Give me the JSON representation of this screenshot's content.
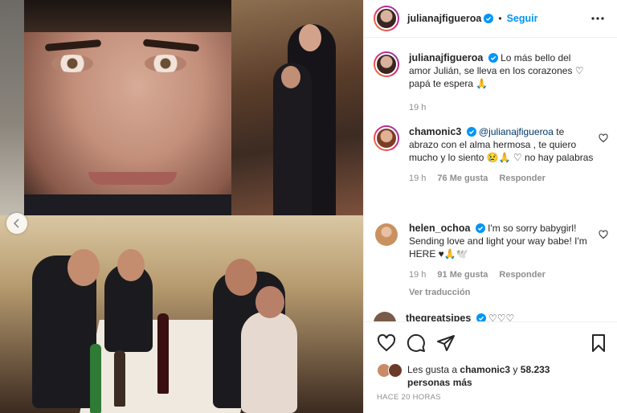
{
  "post": {
    "author": "julianajfiguerоa",
    "follow_label": "Seguir",
    "separator": "•"
  },
  "caption": {
    "username": "julianajfigueroa",
    "text": "Lo más bello del amor Julián, se lleva en los corazones ♡ papá te espera 🙏",
    "time": "19 h"
  },
  "comments": [
    {
      "username": "chamonic3",
      "mention": "@julianajfigueroa",
      "text": " te abrazo con el alma hermosa , te quiero mucho y lo siento 😢🙏 ♡ no hay palabras",
      "time": "19 h",
      "likes": "76 Me gusta",
      "reply": "Responder"
    },
    {
      "username": "helen_ochoa",
      "text": "I'm so sorry babygirl! Sending love and light your way babe! I'm HERE ♥🙏🕊️",
      "time": "19 h",
      "likes": "91 Me gusta",
      "reply": "Responder",
      "translate": "Ver traducción"
    },
    {
      "username": "thegreatsipes",
      "text": "♡♡♡"
    }
  ],
  "likes_line": {
    "prefix": "Les gusta a ",
    "user": "chamonic3",
    "middle": " y ",
    "count": "58.233",
    "suffix": "personas más"
  },
  "timestamp": "HACE 20 HORAS",
  "colors": {
    "accent": "#0095f6",
    "verified": "#0095f6",
    "muted": "#8e8e8e"
  },
  "icons": [
    "chevron-left-icon",
    "more-icon",
    "verified-icon",
    "heart-icon",
    "comment-icon",
    "share-icon",
    "bookmark-icon"
  ]
}
